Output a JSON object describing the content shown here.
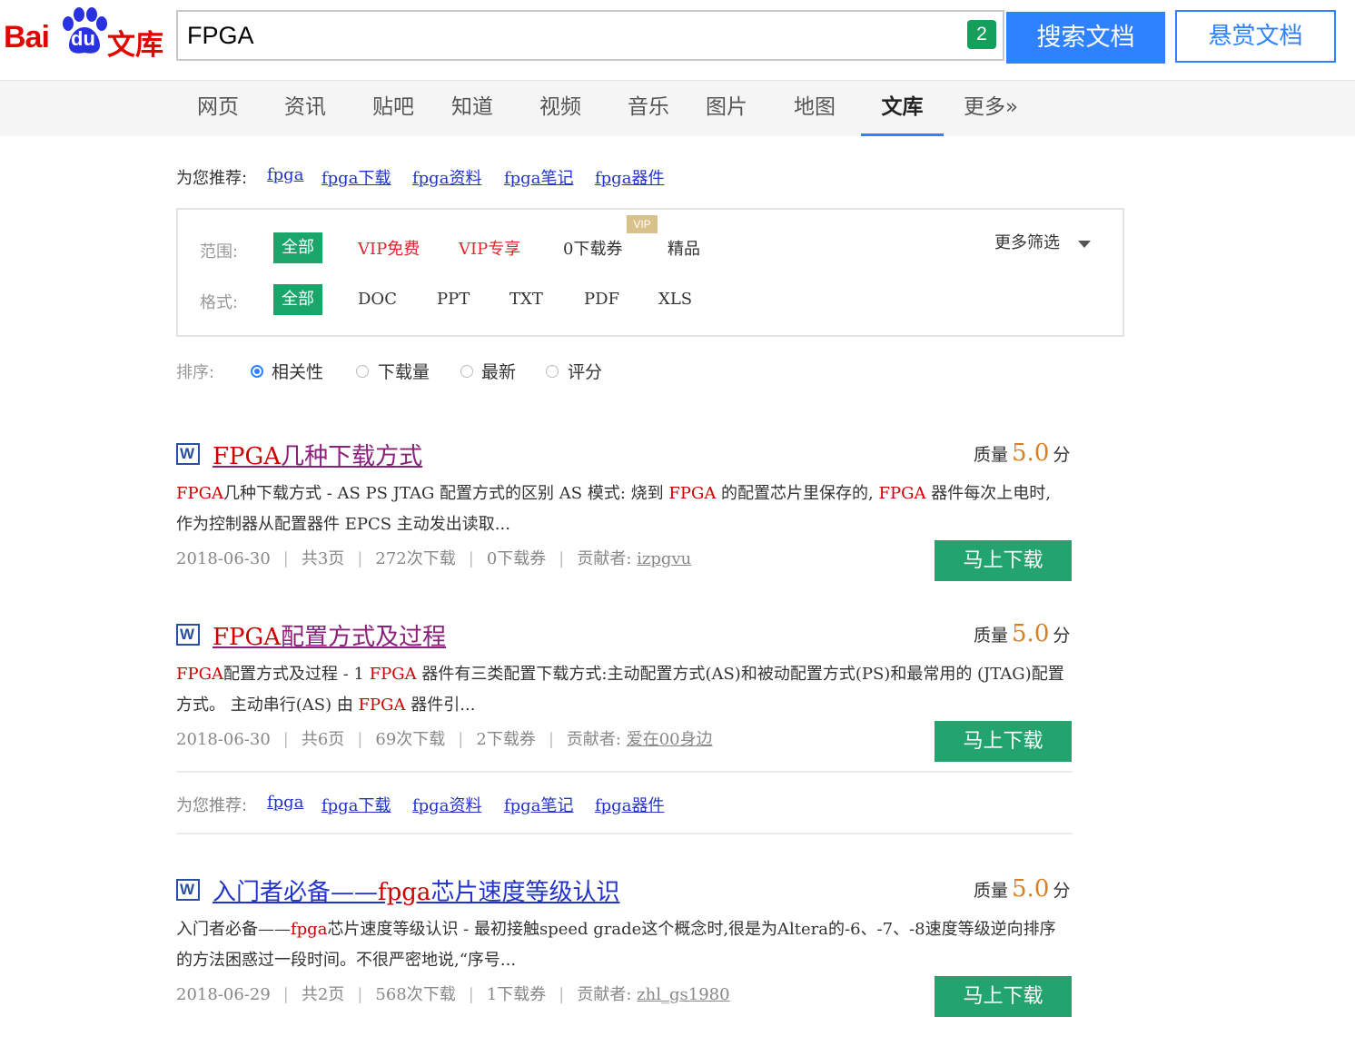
{
  "logo": {
    "bai": "Bai",
    "du": "du",
    "wenku": "文库"
  },
  "search": {
    "value": "FPGA",
    "badge": "2",
    "search_button": "搜索文档",
    "reward_button": "悬赏文档"
  },
  "nav": {
    "items": [
      "网页",
      "资讯",
      "贴吧",
      "知道",
      "视频",
      "音乐",
      "图片",
      "地图",
      "文库",
      "更多»"
    ],
    "active": "文库"
  },
  "recommend": {
    "label": "为您推荐:",
    "links": [
      "fpga",
      "fpga下载",
      "fpga资料",
      "fpga笔记",
      "fpga器件"
    ]
  },
  "filters": {
    "scope_label": "范围:",
    "scope_options": [
      "全部",
      "VIP免费",
      "VIP专享",
      "0下载券",
      "精品"
    ],
    "scope_selected": "全部",
    "vip_tag": "VIP",
    "format_label": "格式:",
    "format_options": [
      "全部",
      "DOC",
      "PPT",
      "TXT",
      "PDF",
      "XLS"
    ],
    "format_selected": "全部",
    "more_filters": "更多筛选"
  },
  "sort": {
    "label": "排序:",
    "options": [
      "相关性",
      "下载量",
      "最新",
      "评分"
    ],
    "selected": "相关性"
  },
  "results": [
    {
      "title_hl": "FPGA",
      "title_rest": "几种下载方式",
      "quality_label": "质量",
      "score": "5.0",
      "unit": "分",
      "desc": {
        "a_hl": "FPGA",
        "a": "几种下载方式 - AS PS JTAG 配置方式的区别 AS 模式: 烧到 ",
        "b_hl": "FPGA",
        "b": " 的配置芯片里保存的, ",
        "c_hl": "FPGA",
        "c": " 器件每次上电时, 作为控制器从配置器件 EPCS 主动发出读取..."
      },
      "date": "2018-06-30",
      "pages": "共3页",
      "downloads": "272次下载",
      "coupons": "0下载券",
      "contributor_label": "贡献者:",
      "contributor": "izpgvu",
      "button": "马上下载"
    },
    {
      "title_hl": "FPGA",
      "title_rest": "配置方式及过程",
      "quality_label": "质量",
      "score": "5.0",
      "unit": "分",
      "desc": {
        "a_hl": "FPGA",
        "a": "配置方式及过程 - 1 ",
        "b_hl": "FPGA",
        "b": " 器件有三类配置下载方式:主动配置方式(AS)和被动配置方式(PS)和最常用的 (JTAG)配置方式。 主动串行(AS) 由 ",
        "c_hl": "FPGA",
        "c": " 器件引..."
      },
      "date": "2018-06-30",
      "pages": "共6页",
      "downloads": "69次下载",
      "coupons": "2下载券",
      "contributor_label": "贡献者:",
      "contributor": "爱在00身边",
      "button": "马上下载"
    },
    {
      "title_a": "入门者必备——",
      "title_hl": "fpga",
      "title_rest": "芯片速度等级认识",
      "quality_label": "质量",
      "score": "5.0",
      "unit": "分",
      "desc": {
        "a": "入门者必备——",
        "a_hl": "fpga",
        "b": "芯片速度等级认识 - 最初接触speed grade这个概念时,很是为Altera的-6、-7、-8速度等级逆向排序的方法困惑过一段时间。不很严密地说,“序号..."
      },
      "date": "2018-06-29",
      "pages": "共2页",
      "downloads": "568次下载",
      "coupons": "1下载券",
      "contributor_label": "贡献者:",
      "contributor": "zhl_gs1980",
      "button": "马上下载"
    }
  ],
  "colors": {
    "accent_blue": "#2e82ff",
    "green": "#23a46f",
    "red": "#e10602",
    "highlight": "#cc0000",
    "score": "#d9801f"
  }
}
